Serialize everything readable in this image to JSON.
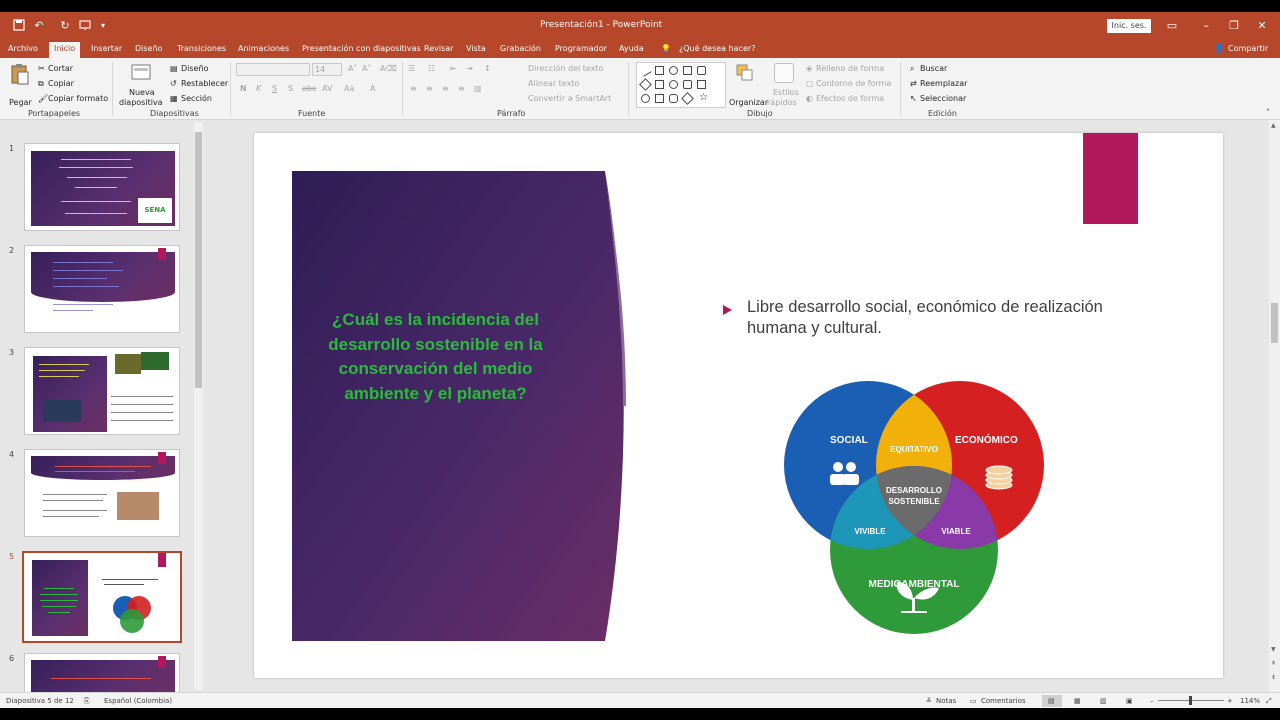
{
  "titlebar": {
    "doc_title": "Presentación1 - PowerPoint",
    "sign_in": "Inic. ses.",
    "save_icon": "save-icon",
    "undo_icon": "undo-icon",
    "redo_icon": "redo-icon",
    "present_icon": "present-from-start-icon",
    "customize_icon": "customize-toolbar-icon",
    "ribbon_display_icon": "ribbon-display-options-icon",
    "minimize_icon": "minimize-icon",
    "restore_icon": "restore-icon",
    "close_icon": "close-icon"
  },
  "tabs": {
    "archivo": "Archivo",
    "inicio": "Inicio",
    "insertar": "Insertar",
    "diseno": "Diseño",
    "transiciones": "Transiciones",
    "animaciones": "Animaciones",
    "presentacion": "Presentación con diapositivas",
    "revisar": "Revisar",
    "vista": "Vista",
    "grabacion": "Grabación",
    "programador": "Programador",
    "ayuda": "Ayuda",
    "tell_me": "¿Qué desea hacer?",
    "share": "Compartir"
  },
  "ribbon": {
    "paste": "Pegar",
    "cut": "Cortar",
    "copy": "Copiar",
    "format_painter": "Copiar formato",
    "clipboard_group": "Portapapeles",
    "new_slide_1": "Nueva",
    "new_slide_2": "diapositiva",
    "layout": "Diseño",
    "reset": "Restablecer",
    "section": "Sección",
    "slides_group": "Diapositivas",
    "font_size": "14",
    "bold": "N",
    "italic": "K",
    "underline": "S",
    "shadow": "S",
    "strike": "abc",
    "spacing": "AV",
    "case": "Aa",
    "font_group": "Fuente",
    "text_direction": "Dirección del texto",
    "align_text": "Alinear texto",
    "smartart": "Convertir a SmartArt",
    "paragraph_group": "Párrafo",
    "arrange": "Organizar",
    "quick_styles_1": "Estilos",
    "quick_styles_2": "rápidos",
    "shape_fill": "Relleno de forma",
    "shape_outline": "Contorno de forma",
    "shape_effects": "Efectos de forma",
    "drawing_group": "Dibujo",
    "find": "Buscar",
    "replace": "Reemplazar",
    "select": "Seleccionar",
    "editing_group": "Edición"
  },
  "thumbnails": [
    {
      "num": "1"
    },
    {
      "num": "2"
    },
    {
      "num": "3"
    },
    {
      "num": "4"
    },
    {
      "num": "5"
    },
    {
      "num": "6"
    }
  ],
  "thumb1": {
    "logo": "SENA"
  },
  "slide": {
    "question": "¿Cuál es la incidencia del desarrollo sostenible en la conservación del medio ambiente y el planeta?",
    "bullet": "Libre desarrollo social, económico de realización humana y cultural."
  },
  "venn": {
    "social": "SOCIAL",
    "economico": "ECONÓMICO",
    "medioambiental": "MEDIOAMBIENTAL",
    "equitativo": "EQUITATIVO",
    "vivible": "VIVIBLE",
    "viable": "VIABLE",
    "center_1": "DESARROLLO",
    "center_2": "SOSTENIBLE",
    "colors": {
      "social": "#1a5fb4",
      "economico": "#d42020",
      "medio": "#2e9a3a",
      "equitativo": "#f2b10a",
      "vivible": "#1e96b8",
      "viable": "#8a3aa8",
      "center": "#6b6b6b"
    }
  },
  "status": {
    "slide_info": "Diapositiva 5 de 12",
    "language": "Español (Colombia)",
    "notes": "Notas",
    "comments": "Comentarios",
    "zoom": "114%"
  }
}
